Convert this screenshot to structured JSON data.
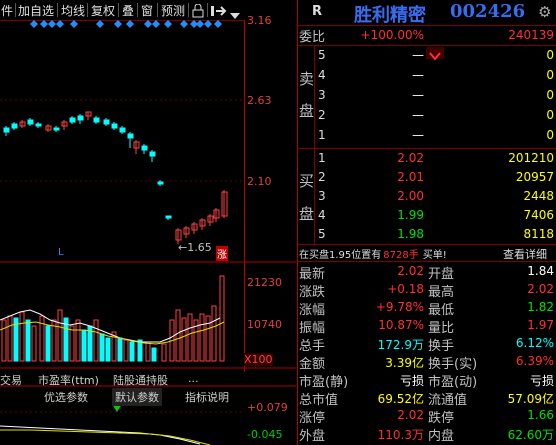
{
  "toolbar": {
    "items": [
      "件",
      "加自选",
      "均线",
      "复权",
      "叠",
      "窗",
      "预测"
    ],
    "lock_icon": "lock-icon",
    "exit_icon": "exit-icon",
    "dropdown_icon": "chevron-down-icon"
  },
  "chart": {
    "price_ticks": [
      "3.16",
      "2.63",
      "2.10"
    ],
    "low_marker": "1.65",
    "zhang_badge": "涨",
    "l_label": "L",
    "vol_ticks": [
      "21230",
      "10740",
      "X100"
    ],
    "indicator_tabs": [
      "交易",
      "市盈率(ttm)",
      "陆股通持股",
      "..."
    ],
    "subtabs": [
      "优选参数",
      "默认参数",
      "指标说明"
    ],
    "osc_ticks": [
      "+0.079",
      "-0.045"
    ]
  },
  "quote": {
    "r_label": "R",
    "name": "胜利精密",
    "code": "002426",
    "wei_label": "委比",
    "wei_ratio": "+100.00%",
    "wei_diff": "240139",
    "sell_label": "卖盘",
    "sell_label_chars": [
      "卖",
      "盘"
    ],
    "sell": [
      {
        "n": "5",
        "p": "—",
        "v": "0"
      },
      {
        "n": "4",
        "p": "—",
        "v": "0"
      },
      {
        "n": "3",
        "p": "—",
        "v": "0"
      },
      {
        "n": "2",
        "p": "—",
        "v": "0"
      },
      {
        "n": "1",
        "p": "—",
        "v": "0"
      }
    ],
    "buy_label_chars": [
      "买",
      "盘"
    ],
    "buy": [
      {
        "n": "1",
        "p": "2.02",
        "v": "201210"
      },
      {
        "n": "2",
        "p": "2.01",
        "v": "20957"
      },
      {
        "n": "3",
        "p": "2.00",
        "v": "2448"
      },
      {
        "n": "4",
        "p": "1.99",
        "v": "7406"
      },
      {
        "n": "5",
        "p": "1.98",
        "v": "8118"
      }
    ],
    "notice_pre": "在买盘1.95位置有",
    "notice_qty": "8728手",
    "notice_post": "买单!",
    "notice_link": "查看详细",
    "stats": [
      {
        "l": "最新",
        "v": "2.02",
        "l2": "开盘",
        "v2": "1.84"
      },
      {
        "l": "涨跌",
        "v": "+0.18",
        "l2": "最高",
        "v2": "2.02"
      },
      {
        "l": "涨幅",
        "v": "+9.78%",
        "l2": "最低",
        "v2": "1.82"
      },
      {
        "l": "振幅",
        "v": "10.87%",
        "l2": "量比",
        "v2": "1.97"
      },
      {
        "l": "总手",
        "v": "172.9万",
        "l2": "换手",
        "v2": "6.12%"
      },
      {
        "l": "金额",
        "v": "3.39亿",
        "l2": "换手(实)",
        "v2": "6.39%"
      },
      {
        "l": "市盈(静)",
        "v": "亏损",
        "l2": "市盈(动)",
        "v2": "亏损"
      },
      {
        "l": "总市值",
        "v": "69.52亿",
        "l2": "流通值",
        "v2": "57.09亿"
      },
      {
        "l": "涨停",
        "v": "2.02",
        "l2": "跌停",
        "v2": "1.66"
      },
      {
        "l": "外盘",
        "v": "110.3万",
        "l2": "内盘",
        "v2": "62.60万"
      }
    ]
  }
}
